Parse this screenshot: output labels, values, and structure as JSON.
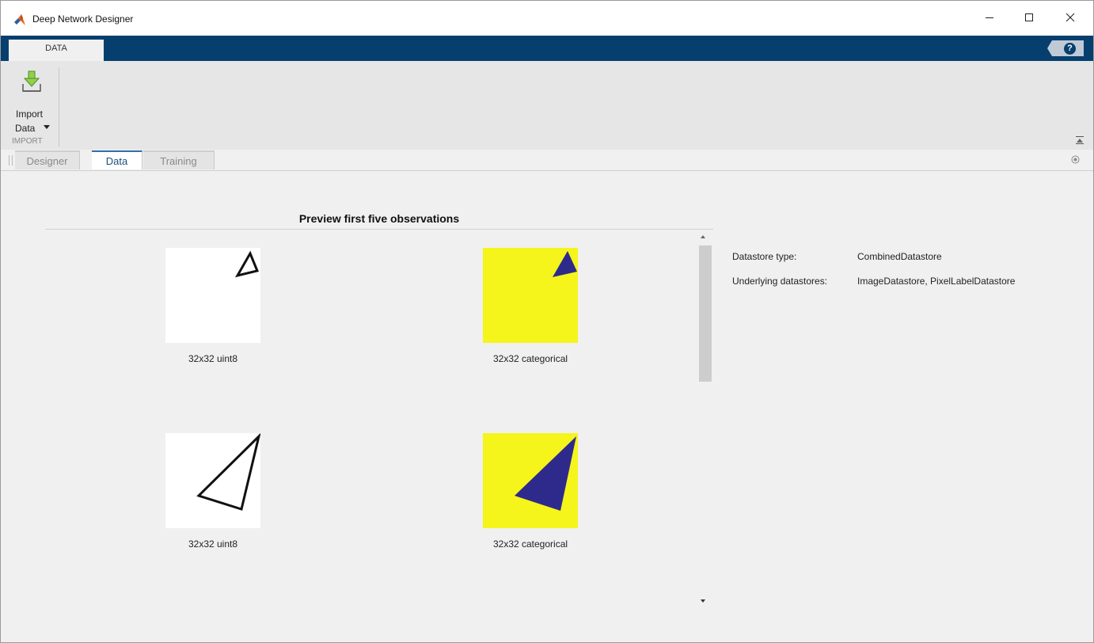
{
  "window": {
    "title": "Deep Network Designer"
  },
  "ribbon": {
    "tab_label": "DATA",
    "help_icon_glyph": "?",
    "import_button": {
      "line1": "Import",
      "line2": "Data"
    },
    "group_label": "IMPORT"
  },
  "doc_tabs": [
    {
      "label": "Designer",
      "active": false
    },
    {
      "label": "Data",
      "active": true
    },
    {
      "label": "Training",
      "active": false
    }
  ],
  "preview": {
    "title": "Preview first five observations",
    "observations": [
      {
        "input_caption": "32x32 uint8",
        "label_caption": "32x32 categorical"
      },
      {
        "input_caption": "32x32 uint8",
        "label_caption": "32x32 categorical"
      }
    ]
  },
  "datastore_info": {
    "type_label": "Datastore type:",
    "type_value": "CombinedDatastore",
    "underlying_label": "Underlying datastores:",
    "underlying_value": "ImageDatastore, PixelLabelDatastore"
  },
  "colors": {
    "ribbon_blue": "#063f6e",
    "label_background": "#f5f51b",
    "label_shape": "#2e2a8c",
    "active_tab_accent": "#2f6fae"
  }
}
